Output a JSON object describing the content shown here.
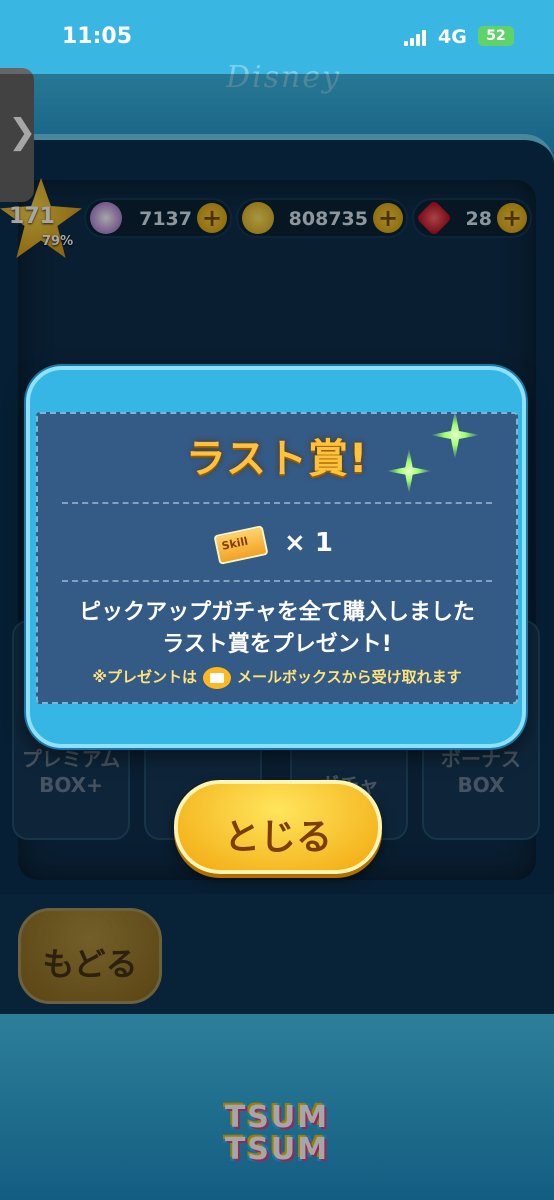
{
  "status_bar": {
    "time": "11:05",
    "network": "4G",
    "battery": "52"
  },
  "header": {
    "disney_logo": "Disney"
  },
  "side_tab": {
    "glyph": "❯"
  },
  "player": {
    "level": "171",
    "level_progress": "79%",
    "resources": [
      {
        "name": "tickets",
        "icon": "gem-icon",
        "value": "7137"
      },
      {
        "name": "coins",
        "icon": "coin-icon",
        "value": "808735"
      },
      {
        "name": "rubies",
        "icon": "ruby-icon",
        "value": "28"
      }
    ],
    "plus_label": "+"
  },
  "background_cards": [
    {
      "label": "プレミアム\nBOX+"
    },
    {
      "label": ""
    },
    {
      "label": "ガチャ"
    },
    {
      "label": "ボーナス\nBOX"
    }
  ],
  "modal": {
    "title": "ラスト賞!",
    "reward_icon": "skill-ticket-icon",
    "reward_ticket_text": "Skill",
    "reward_quantity": "× 1",
    "message_line1": "ピックアップガチャを全て購入しました",
    "message_line2": "ラスト賞をプレゼント!",
    "note_prefix": "※プレゼントは",
    "note_icon": "mail-icon",
    "note_suffix": "メールボックスから受け取れます"
  },
  "buttons": {
    "close": "とじる",
    "back": "もどる"
  },
  "footer": {
    "logo_line1": "TSUM",
    "logo_line2": "TSUM"
  },
  "colors": {
    "accent_blue": "#3ab6e2",
    "gold": "#ffc23c",
    "panel": "#345a86"
  }
}
